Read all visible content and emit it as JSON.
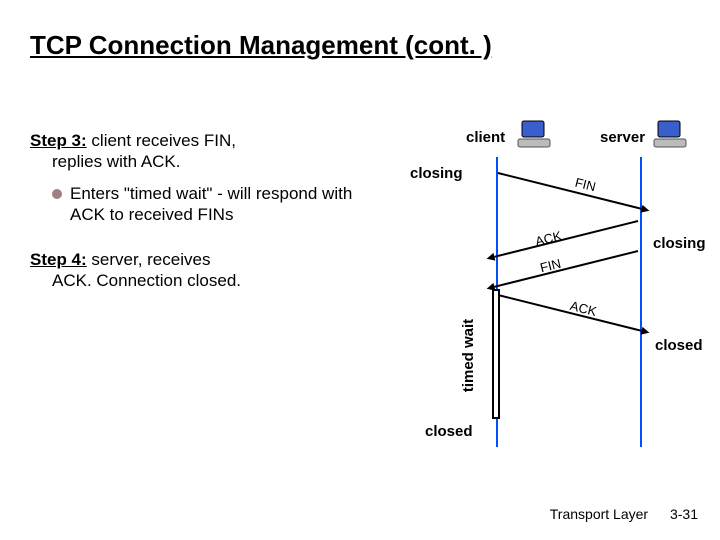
{
  "title": "TCP Connection Management (cont. )",
  "step3": {
    "header": "Step 3:",
    "body_a": " client receives FIN,",
    "body_b": "replies with ACK.",
    "sub": "Enters \"timed wait\" - will respond with ACK to received FINs"
  },
  "step4": {
    "header": "Step 4:",
    "body_a": " server, receives",
    "body_b": "ACK.  Connection closed."
  },
  "diagram": {
    "client_label": "client",
    "server_label": "server",
    "closing_left": "closing",
    "closing_right": "closing",
    "closed_left": "closed",
    "closed_right": "closed",
    "timed_wait": "timed wait",
    "msgs": {
      "fin1": "FIN",
      "ack1": "ACK",
      "fin2": "FIN",
      "ack2": "ACK"
    }
  },
  "footer": {
    "layer": "Transport Layer",
    "page": "3-31"
  }
}
